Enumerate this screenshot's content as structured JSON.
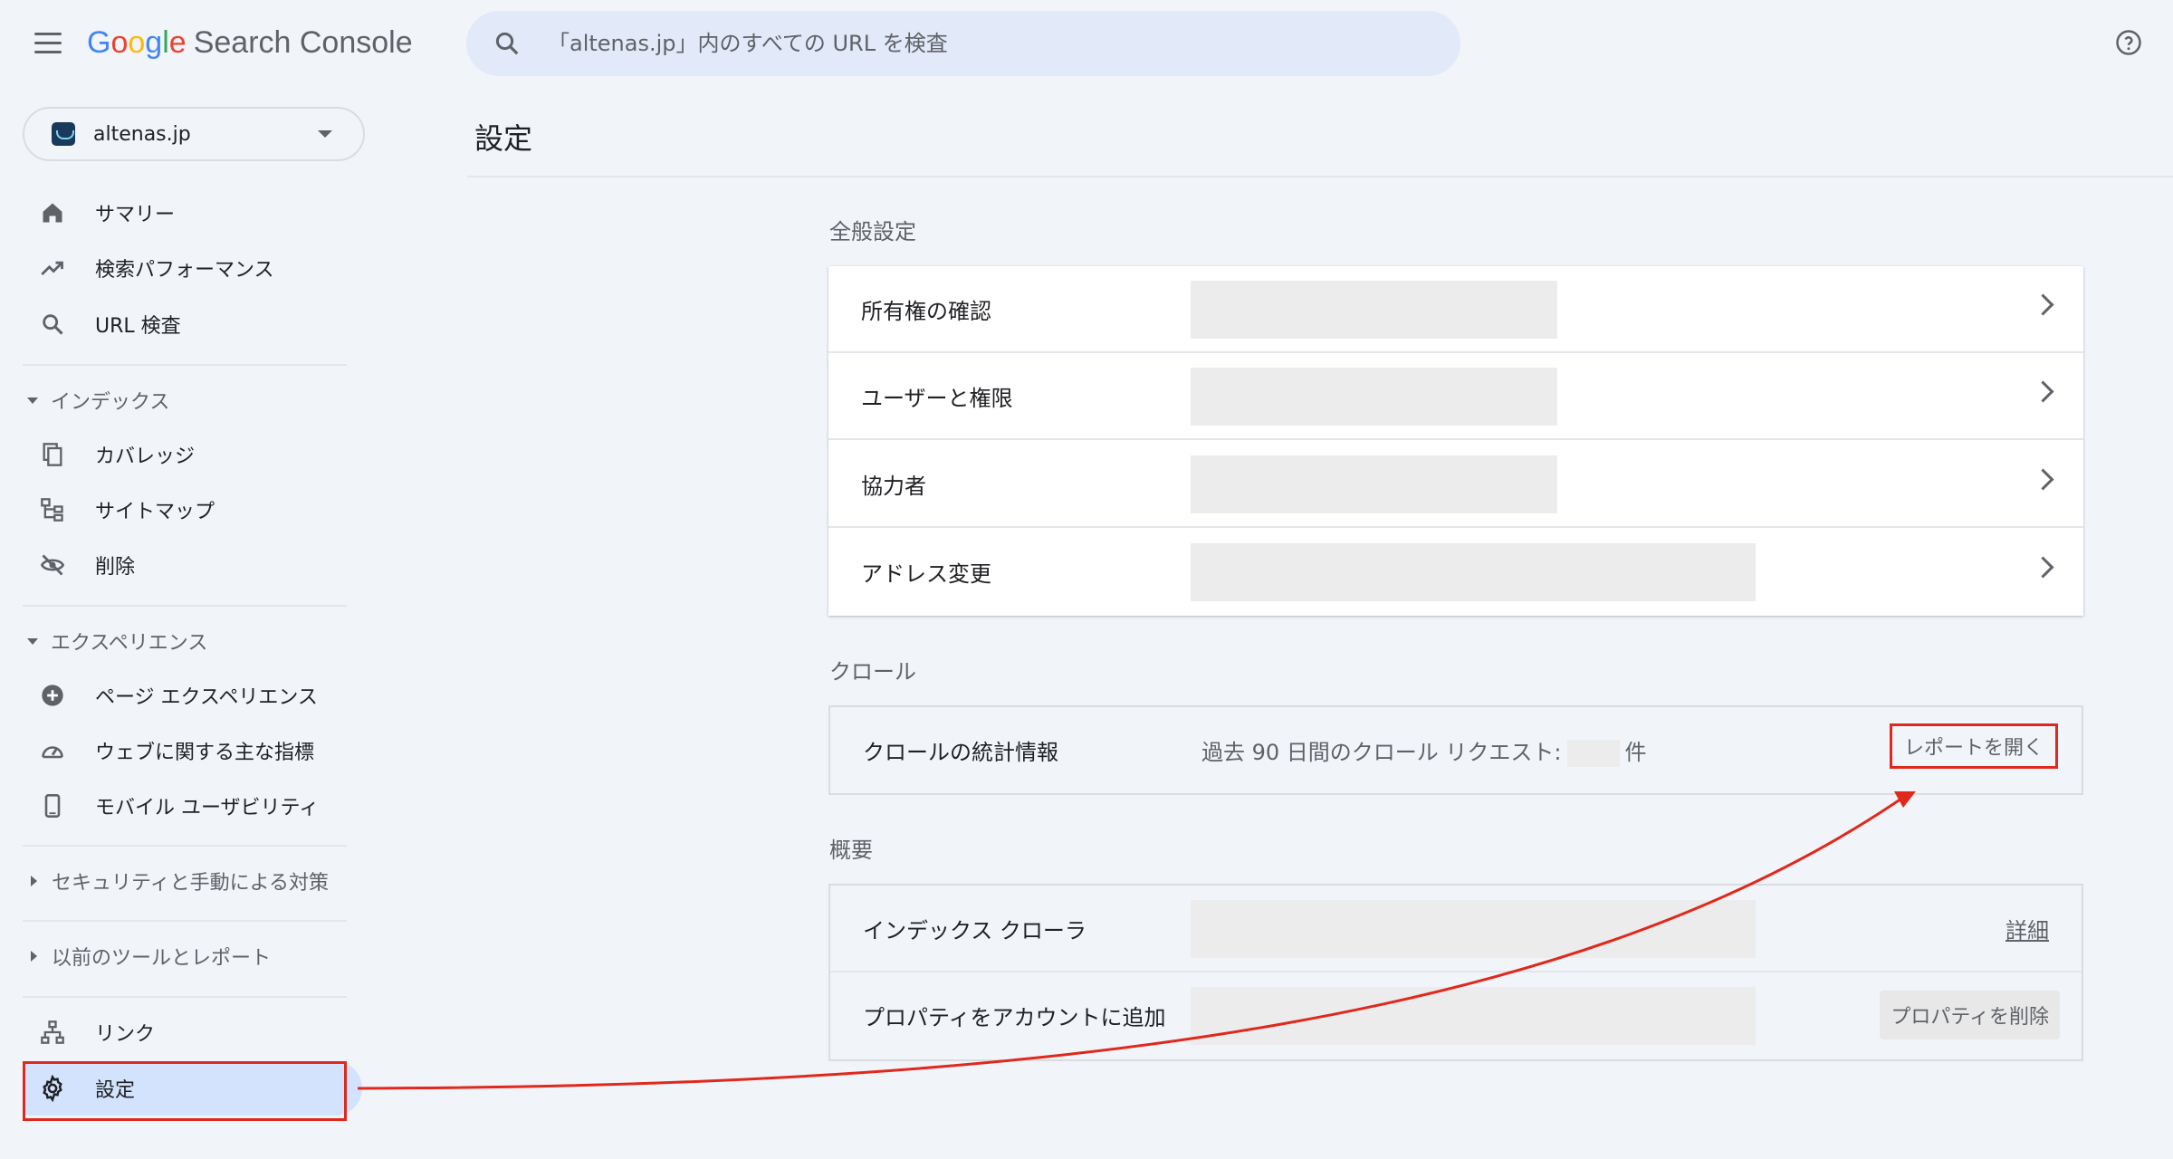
{
  "header": {
    "logo_letters": [
      "G",
      "o",
      "o",
      "g",
      "l",
      "e"
    ],
    "logo_colors": [
      "#4285f4",
      "#ea4335",
      "#fbbc05",
      "#4285f4",
      "#34a853",
      "#ea4335"
    ],
    "logo_product": "Search Console",
    "search_placeholder": "「altenas.jp」内のすべての URL を検査"
  },
  "property": {
    "name": "altenas.jp"
  },
  "sidebar": {
    "items_top": [
      {
        "label": "サマリー",
        "icon": "home-icon"
      },
      {
        "label": "検索パフォーマンス",
        "icon": "trending-up-icon"
      },
      {
        "label": "URL 検査",
        "icon": "search-icon"
      }
    ],
    "index": {
      "title": "インデックス",
      "items": [
        {
          "label": "カバレッジ",
          "icon": "copy-icon"
        },
        {
          "label": "サイトマップ",
          "icon": "sitemap-icon"
        },
        {
          "label": "削除",
          "icon": "eye-off-icon"
        }
      ]
    },
    "experience": {
      "title": "エクスペリエンス",
      "items": [
        {
          "label": "ページ エクスペリエンス",
          "icon": "plus-circle-icon"
        },
        {
          "label": "ウェブに関する主な指標",
          "icon": "speed-icon"
        },
        {
          "label": "モバイル ユーザビリティ",
          "icon": "phone-icon"
        }
      ]
    },
    "security_title": "セキュリティと手動による対策",
    "legacy_title": "以前のツールとレポート",
    "links_label": "リンク",
    "settings_label": "設定"
  },
  "main": {
    "page_title": "設定",
    "general": {
      "heading": "全般設定",
      "rows": [
        {
          "label": "所有権の確認"
        },
        {
          "label": "ユーザーと権限"
        },
        {
          "label": "協力者"
        },
        {
          "label": "アドレス変更"
        }
      ]
    },
    "crawl": {
      "heading": "クロール",
      "row_label": "クロールの統計情報",
      "stat_prefix": "過去 90 日間のクロール リクエスト:",
      "stat_suffix": "件",
      "open_report": "レポートを開く"
    },
    "overview": {
      "heading": "概要",
      "indexer_label": "インデックス クローラ",
      "detail_link": "詳細",
      "account_label": "プロパティをアカウントに追加",
      "remove_button": "プロパティを削除"
    }
  },
  "colors": {
    "accent_red": "#e0281c",
    "active_bg": "#d3e3fd"
  }
}
